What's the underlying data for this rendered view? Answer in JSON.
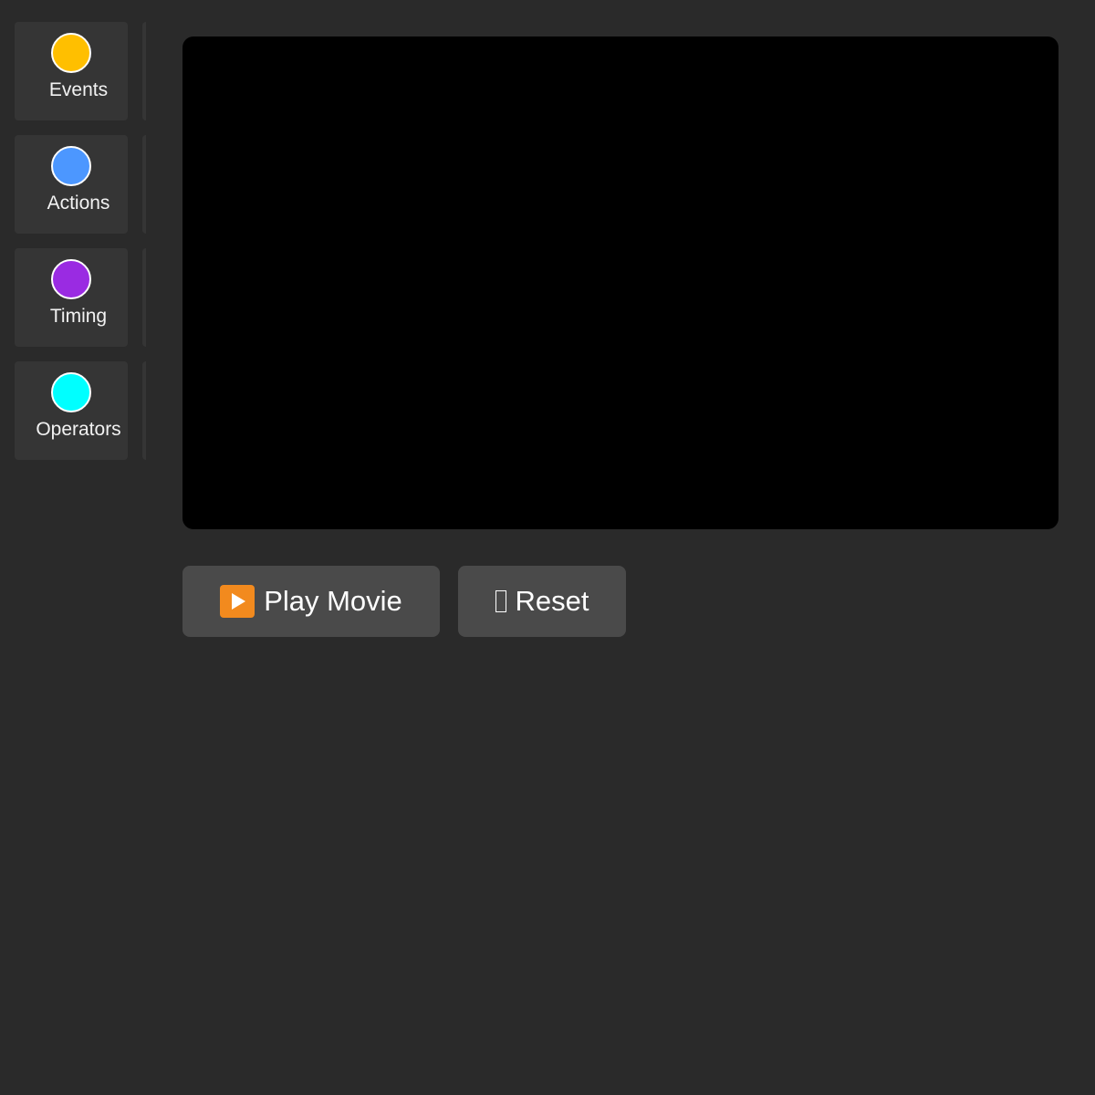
{
  "palette": {
    "categories": [
      {
        "label": "Events",
        "color": "#ffbf00"
      },
      {
        "label": "Actions",
        "color": "#4c97ff"
      },
      {
        "label": "Timing",
        "color": "#9a2be2"
      },
      {
        "label": "Operators",
        "color": "#00ffff"
      }
    ]
  },
  "controls": {
    "play_label": "Play Movie",
    "reset_label": "Reset"
  }
}
